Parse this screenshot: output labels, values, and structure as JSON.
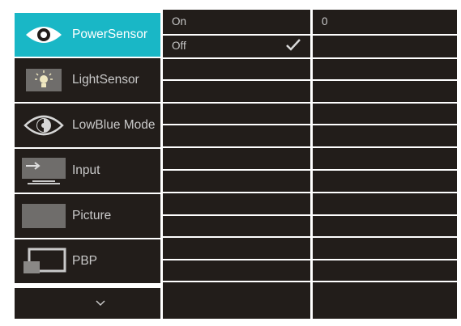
{
  "menu": {
    "items": [
      {
        "label": "PowerSensor",
        "icon": "eye-icon",
        "selected": true
      },
      {
        "label": "LightSensor",
        "icon": "light-bulb-icon",
        "selected": false
      },
      {
        "label": "LowBlue Mode",
        "icon": "low-blue-eye-icon",
        "selected": false
      },
      {
        "label": "Input",
        "icon": "input-arrow-icon",
        "selected": false
      },
      {
        "label": "Picture",
        "icon": "picture-icon",
        "selected": false
      },
      {
        "label": "PBP",
        "icon": "pbp-icon",
        "selected": false
      }
    ],
    "scroll_icon": "chevron-down-icon"
  },
  "submenu": {
    "options": [
      {
        "label": "On",
        "checked": false
      },
      {
        "label": "Off",
        "checked": true
      }
    ]
  },
  "value_panel": {
    "value": "0"
  },
  "colors": {
    "accent": "#19b7c6",
    "panel": "#221d1a",
    "text": "#c9c9c9"
  }
}
